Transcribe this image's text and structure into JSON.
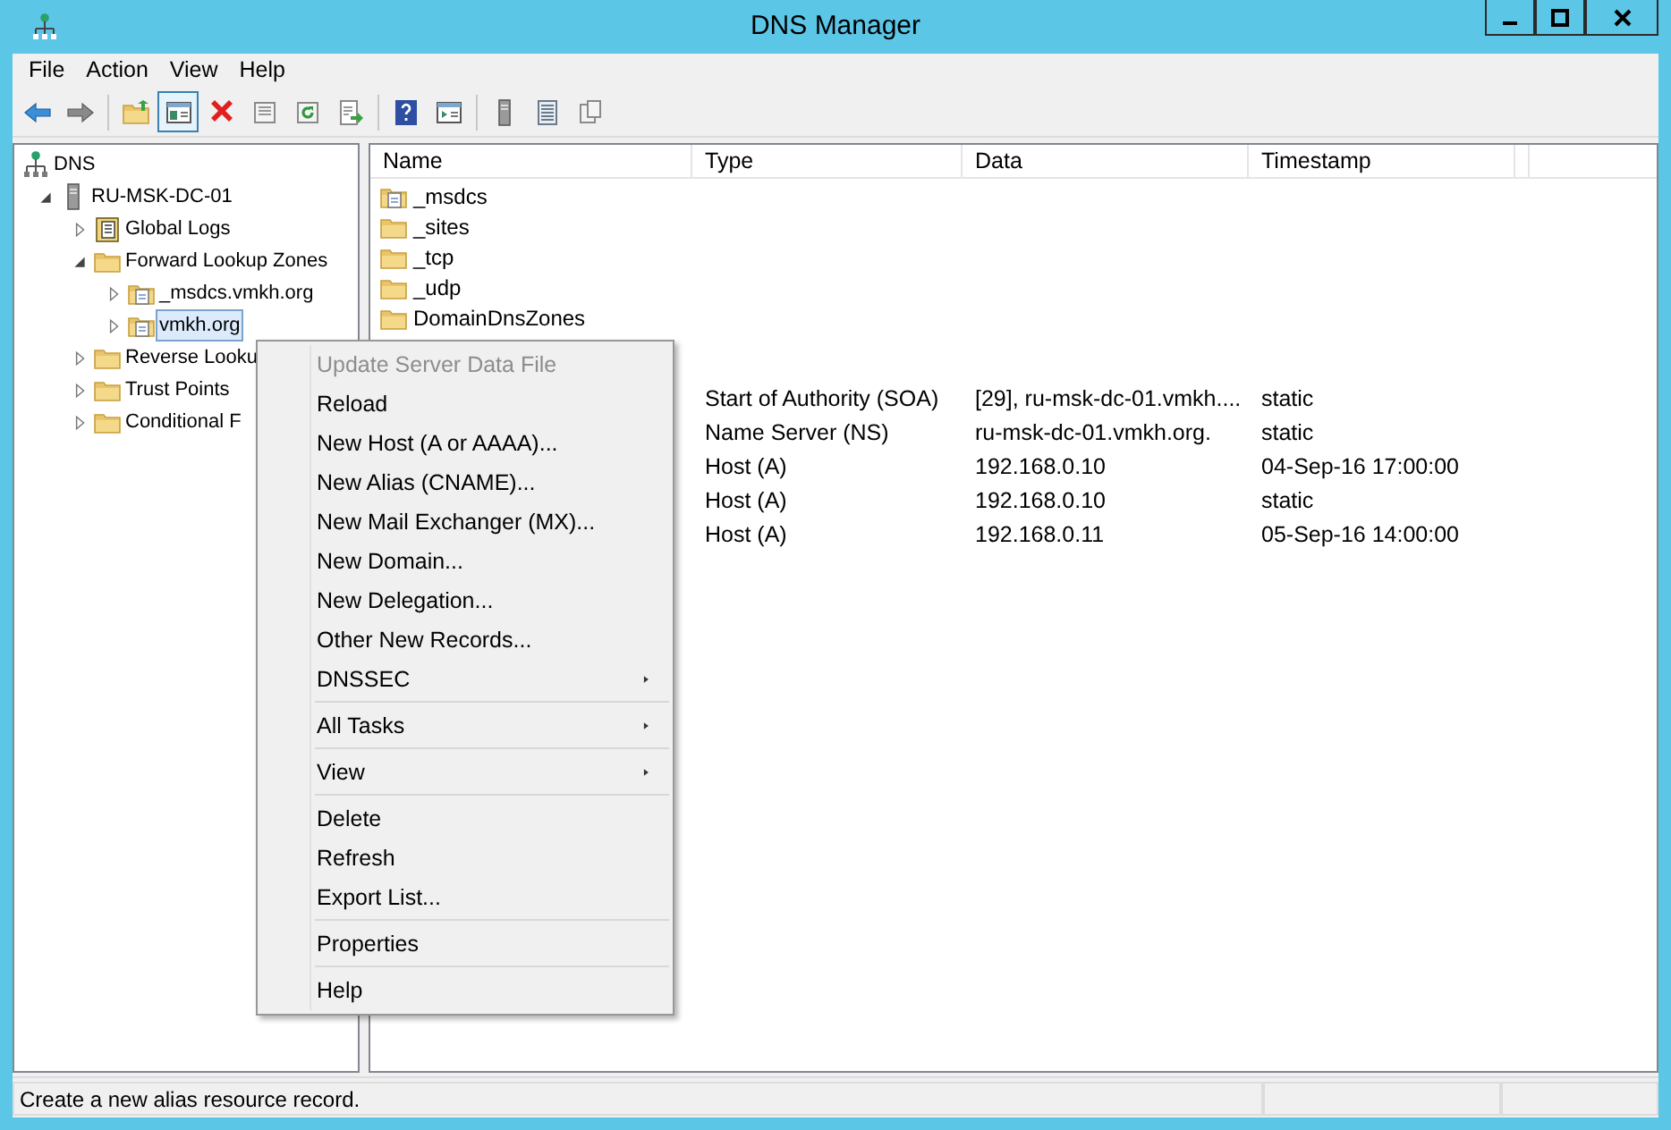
{
  "window": {
    "title": "DNS Manager"
  },
  "menu_bar": [
    "File",
    "Action",
    "View",
    "Help"
  ],
  "toolbar": [
    {
      "kind": "back",
      "pressed": false
    },
    {
      "kind": "forward",
      "pressed": false
    },
    {
      "kind": "separator"
    },
    {
      "kind": "up",
      "pressed": false
    },
    {
      "kind": "console-tree",
      "pressed": true
    },
    {
      "kind": "delete",
      "pressed": false
    },
    {
      "kind": "properties",
      "pressed": false
    },
    {
      "kind": "refresh",
      "pressed": false
    },
    {
      "kind": "export",
      "pressed": false
    },
    {
      "kind": "separator"
    },
    {
      "kind": "help",
      "pressed": false
    },
    {
      "kind": "action-pane",
      "pressed": false
    },
    {
      "kind": "separator"
    },
    {
      "kind": "server",
      "pressed": false
    },
    {
      "kind": "list",
      "pressed": false
    },
    {
      "kind": "copy",
      "pressed": false
    }
  ],
  "tree": [
    {
      "label": "DNS",
      "kind": "dns",
      "selected": false,
      "children": [
        {
          "label": "RU-MSK-DC-01",
          "kind": "server",
          "selected": false,
          "expanded": true,
          "children": [
            {
              "label": "Global Logs",
              "kind": "logs",
              "selected": false,
              "expanded": false
            },
            {
              "label": "Forward Lookup Zones",
              "kind": "folder",
              "selected": false,
              "expanded": true,
              "children": [
                {
                  "label": "_msdcs.vmkh.org",
                  "kind": "zone",
                  "selected": false,
                  "expanded": false
                },
                {
                  "label": "vmkh.org",
                  "kind": "zone",
                  "selected": true,
                  "expanded": false
                }
              ]
            },
            {
              "label": "Reverse Looku",
              "kind": "folder",
              "selected": false,
              "expanded": false
            },
            {
              "label": "Trust Points",
              "kind": "folder",
              "selected": false,
              "expanded": false
            },
            {
              "label": "Conditional F",
              "kind": "folder",
              "selected": false,
              "expanded": false
            }
          ]
        }
      ]
    }
  ],
  "list": {
    "columns": [
      "Name",
      "Type",
      "Data",
      "Timestamp"
    ],
    "folders": [
      {
        "name": "_msdcs",
        "kind": "zone"
      },
      {
        "name": "_sites",
        "kind": "folder"
      },
      {
        "name": "_tcp",
        "kind": "folder"
      },
      {
        "name": "_udp",
        "kind": "folder"
      },
      {
        "name": "DomainDnsZones",
        "kind": "folder"
      }
    ],
    "records": [
      {
        "type": "Start of Authority (SOA)",
        "data": "[29], ru-msk-dc-01.vmkh....",
        "timestamp": "static"
      },
      {
        "type": "Name Server (NS)",
        "data": "ru-msk-dc-01.vmkh.org.",
        "timestamp": "static"
      },
      {
        "type": "Host (A)",
        "data": "192.168.0.10",
        "timestamp": "04-Sep-16 17:00:00"
      },
      {
        "type": "Host (A)",
        "data": "192.168.0.10",
        "timestamp": "static"
      },
      {
        "type": "Host (A)",
        "data": "192.168.0.11",
        "timestamp": "05-Sep-16 14:00:00"
      }
    ]
  },
  "context_menu": [
    {
      "label": "Update Server Data File",
      "kind": "item",
      "disabled": true
    },
    {
      "label": "Reload",
      "kind": "item",
      "disabled": false
    },
    {
      "label": "New Host (A or AAAA)...",
      "kind": "item",
      "disabled": false
    },
    {
      "label": "New Alias (CNAME)...",
      "kind": "item",
      "disabled": false
    },
    {
      "label": "New Mail Exchanger (MX)...",
      "kind": "item",
      "disabled": false
    },
    {
      "label": "New Domain...",
      "kind": "item",
      "disabled": false
    },
    {
      "label": "New Delegation...",
      "kind": "item",
      "disabled": false
    },
    {
      "label": "Other New Records...",
      "kind": "item",
      "disabled": false
    },
    {
      "label": "DNSSEC",
      "kind": "submenu",
      "disabled": false
    },
    {
      "kind": "separator"
    },
    {
      "label": "All Tasks",
      "kind": "submenu",
      "disabled": false
    },
    {
      "kind": "separator"
    },
    {
      "label": "View",
      "kind": "submenu",
      "disabled": false
    },
    {
      "kind": "separator"
    },
    {
      "label": "Delete",
      "kind": "item",
      "disabled": false
    },
    {
      "label": "Refresh",
      "kind": "item",
      "disabled": false
    },
    {
      "label": "Export List...",
      "kind": "item",
      "disabled": false
    },
    {
      "kind": "separator"
    },
    {
      "label": "Properties",
      "kind": "item",
      "disabled": false
    },
    {
      "kind": "separator"
    },
    {
      "label": "Help",
      "kind": "item",
      "disabled": false
    }
  ],
  "status_bar": {
    "text": "Create a new alias resource record."
  }
}
